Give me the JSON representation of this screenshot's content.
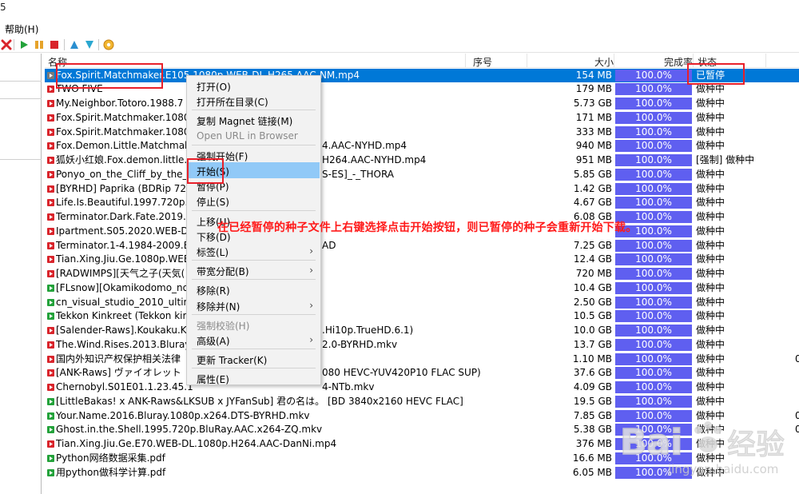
{
  "window": {
    "title_fragment": "5"
  },
  "menubar": {
    "help": "帮助(H)"
  },
  "toolbar": {
    "buttons": [
      {
        "name": "delete-icon",
        "color": "#d9242b"
      },
      {
        "name": "start-icon",
        "color": "#23a23a"
      },
      {
        "name": "pause-icon",
        "color": "#e6a32b"
      },
      {
        "name": "stop-icon",
        "color": "#d9242b"
      },
      {
        "name": "move-up-icon",
        "color": "#2a8fd0"
      },
      {
        "name": "move-down-icon",
        "color": "#2a8fd0"
      },
      {
        "name": "settings-icon",
        "color": "#e8a020"
      }
    ]
  },
  "list": {
    "headers": {
      "name": "名称",
      "order": "序号",
      "size": "大小",
      "progress": "完成率",
      "status": "状态"
    },
    "rows": [
      {
        "icon": "paused",
        "name": "Fox.Spirit.Matchmaker.E105.1080p.WEB-DL.H265.AAC-NM.mp4",
        "size": "154 MB",
        "progress": "100.0%",
        "status": "已暂停",
        "extra": "",
        "selected": true
      },
      {
        "icon": "seeding",
        "name": "TWO FIVE",
        "size": "179 MB",
        "progress": "100.0%",
        "status": "做种中",
        "extra": ""
      },
      {
        "icon": "seeding",
        "name": "My.Neighbor.Totoro.1988.7",
        "size": "5.73 GB",
        "progress": "100.0%",
        "status": "做种中",
        "extra": ""
      },
      {
        "icon": "seeding",
        "name": "Fox.Spirit.Matchmaker.1080",
        "size": "171 MB",
        "progress": "100.0%",
        "status": "做种中",
        "extra": ""
      },
      {
        "icon": "seeding",
        "name": "Fox.Spirit.Matchmaker.1080",
        "size": "333 MB",
        "progress": "100.0%",
        "status": "做种中",
        "extra": ""
      },
      {
        "icon": "seeding",
        "name": "Fox.Demon.Little.Matchmak",
        "tail": "4.AAC-NYHD.mp4",
        "size": "940 MB",
        "progress": "100.0%",
        "status": "做种中",
        "extra": ""
      },
      {
        "icon": "seeding",
        "name": "狐妖小红娘.Fox.demon.little.",
        "tail": "H264.AAC-NYHD.mp4",
        "size": "951 MB",
        "progress": "100.0%",
        "status": "[强制] 做种中",
        "extra": ""
      },
      {
        "icon": "seeding",
        "name": "Ponyo_on_the_Cliff_by_the_",
        "tail": "S-ES]_-_THORA",
        "size": "5.85 GB",
        "progress": "100.0%",
        "status": "做种中",
        "extra": ""
      },
      {
        "icon": "seeding",
        "name": "[BYRHD] Paprika (BDRip 72",
        "size": "1.42 GB",
        "progress": "100.0%",
        "status": "做种中",
        "extra": ""
      },
      {
        "icon": "seeding",
        "name": "Life.Is.Beautiful.1997.720p.B",
        "size": "4.67 GB",
        "progress": "100.0%",
        "status": "做种中",
        "extra": ""
      },
      {
        "icon": "seeding",
        "name": "Terminator.Dark.Fate.2019.",
        "size": "6.08 GB",
        "progress": "100.0%",
        "status": "做种中",
        "extra": ""
      },
      {
        "icon": "seeding",
        "name": "Ipartment.S05.2020.WEB-D",
        "size": "",
        "progress": "100.0%",
        "status": "做种中",
        "extra": ""
      },
      {
        "icon": "seeding",
        "name": "Terminator.1-4.1984-2009.E",
        "tail": "AD",
        "size": "7.25 GB",
        "progress": "100.0%",
        "status": "做种中",
        "extra": ""
      },
      {
        "icon": "seeding",
        "name": "Tian.Xing.Jiu.Ge.1080p.WEB",
        "size": "12.4 GB",
        "progress": "100.0%",
        "status": "做种中",
        "extra": ""
      },
      {
        "icon": "seeding",
        "name": "[RADWIMPS][天气之子(天気(",
        "size": "720 MB",
        "progress": "100.0%",
        "status": "做种中",
        "extra": ""
      },
      {
        "icon": "seeding-green",
        "name": "[FLsnow][Okamikodomo_no",
        "size": "10.4 GB",
        "progress": "100.0%",
        "status": "做种中",
        "extra": ""
      },
      {
        "icon": "seeding-green",
        "name": "cn_visual_studio_2010_ultim",
        "size": "2.50 GB",
        "progress": "100.0%",
        "status": "做种中",
        "extra": ""
      },
      {
        "icon": "seeding-green",
        "name": "Tekkon Kinkreet (Tekkon kir",
        "size": "10.5 GB",
        "progress": "100.0%",
        "status": "做种中",
        "extra": ""
      },
      {
        "icon": "seeding",
        "name": "[Salender-Raws].Koukaku.Ki",
        "tail": ".Hi10p.TrueHD.6.1)",
        "size": "10.0 GB",
        "progress": "100.0%",
        "status": "做种中",
        "extra": ""
      },
      {
        "icon": "seeding",
        "name": "The.Wind.Rises.2013.Bluray.",
        "tail": "2.0-BYRHD.mkv",
        "size": "13.7 GB",
        "progress": "100.0%",
        "status": "做种中",
        "extra": ""
      },
      {
        "icon": "seeding",
        "name": "国内外知识产权保护相关法律",
        "size": "1.10 MB",
        "progress": "100.0%",
        "status": "做种中",
        "extra": "0"
      },
      {
        "icon": "seeding",
        "name": "[ANK-Raws] ヴァイオレット",
        "tail": "080 HEVC-YUV420P10 FLAC SUP)",
        "size": "37.6 GB",
        "progress": "100.0%",
        "status": "做种中",
        "extra": ""
      },
      {
        "icon": "seeding",
        "name": "Chernobyl.S01E01.1.23.45.1",
        "tail": "4-NTb.mkv",
        "size": "4.09 GB",
        "progress": "100.0%",
        "status": "做种中",
        "extra": ""
      },
      {
        "icon": "seeding-green",
        "name": "[LittleBakas! x ANK-Raws&LKSUB x JYFanSub] 君の名は。 [BD 3840x2160 HEVC FLAC]",
        "size": "19.5 GB",
        "progress": "100.0%",
        "status": "做种中",
        "extra": ""
      },
      {
        "icon": "seeding-green",
        "name": "Your.Name.2016.Bluray.1080p.x264.DTS-BYRHD.mkv",
        "size": "7.85 GB",
        "progress": "100.0%",
        "status": "做种中",
        "extra": "0"
      },
      {
        "icon": "seeding-green",
        "name": "Ghost.in.the.Shell.1995.720p.BluRay.AAC.x264-ZQ.mkv",
        "size": "5.38 GB",
        "progress": "100.0%",
        "status": "做种中",
        "extra": "0"
      },
      {
        "icon": "seeding",
        "name": "Tian.Xing.Jiu.Ge.E70.WEB-DL.1080p.H264.AAC-DanNi.mp4",
        "size": "376 MB",
        "progress": "100.0%",
        "status": "做种中",
        "extra": ""
      },
      {
        "icon": "seeding-green",
        "name": "Python网络数据采集.pdf",
        "size": "16.6 MB",
        "progress": "100.0%",
        "status": "做种中",
        "extra": ""
      },
      {
        "icon": "seeding-green",
        "name": "用python做科学计算.pdf",
        "size": "6.05 MB",
        "progress": "100.0%",
        "status": "做种中",
        "extra": ""
      }
    ]
  },
  "context_menu": {
    "items": [
      {
        "label": "打开(O)",
        "enabled": true
      },
      {
        "label": "打开所在目录(C)",
        "enabled": true
      },
      {
        "sep": true
      },
      {
        "label": "复制 Magnet 链接(M)",
        "enabled": true
      },
      {
        "label": "Open URL in Browser",
        "enabled": false
      },
      {
        "sep": true
      },
      {
        "label": "强制开始(F)",
        "enabled": true
      },
      {
        "label": "开始(S)",
        "enabled": true,
        "hot": true
      },
      {
        "label": "暂停(P)",
        "enabled": true
      },
      {
        "label": "停止(S)",
        "enabled": true
      },
      {
        "sep": true
      },
      {
        "label": "上移(U)",
        "enabled": true
      },
      {
        "label": "下移(D)",
        "enabled": true
      },
      {
        "label": "标签(L)",
        "enabled": true,
        "submenu": true
      },
      {
        "sep": true
      },
      {
        "label": "带宽分配(B)",
        "enabled": true,
        "submenu": true
      },
      {
        "sep": true
      },
      {
        "label": "移除(R)",
        "enabled": true
      },
      {
        "label": "移除并(N)",
        "enabled": true,
        "submenu": true
      },
      {
        "sep": true
      },
      {
        "label": "强制校验(H)",
        "enabled": false
      },
      {
        "label": "高级(A)",
        "enabled": true,
        "submenu": true
      },
      {
        "sep": true
      },
      {
        "label": "更新 Tracker(K)",
        "enabled": true
      },
      {
        "sep": true
      },
      {
        "label": "属性(E)",
        "enabled": true
      }
    ]
  },
  "annotation": "在已经暂停的种子文件上右键选择点击开始按钮，则已暂停的种子会重新开始下载。",
  "watermark": {
    "text": "jingyan.baidu.com"
  },
  "colors": {
    "selection": "#0078d7",
    "progress_fill": "#5f5ff0",
    "menu_hot": "#91c9f7",
    "annotation_red": "#ff1a1a",
    "icon_red": "#d9242b",
    "icon_green": "#23a23a"
  }
}
